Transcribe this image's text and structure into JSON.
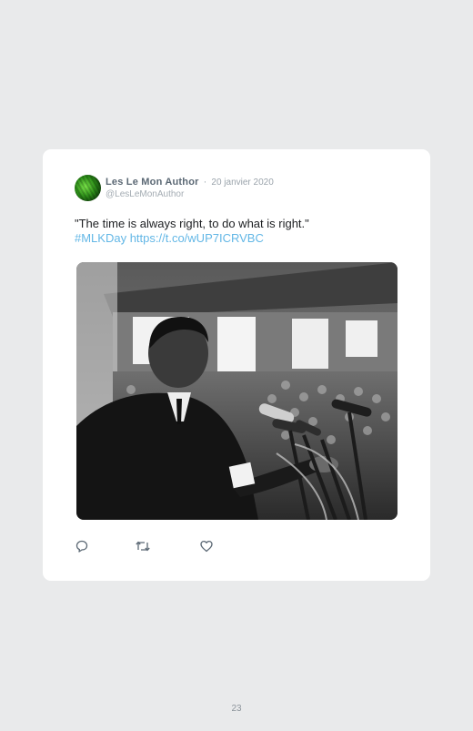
{
  "tweet": {
    "author_name": "Les Le Mon Author",
    "separator": "·",
    "date": "20 janvier 2020",
    "handle": "@LesLeMonAuthor",
    "text": "\"The time is always right, to do what is right.\"",
    "hashtag": "#MLKDay",
    "link": "https://t.co/wUP7ICRVBC",
    "image_alt": "Black and white photo of a man speaking into microphones before a crowd"
  },
  "actions": {
    "reply_icon": "reply-icon",
    "retweet_icon": "retweet-icon",
    "like_icon": "like-icon"
  },
  "page": {
    "number": "23"
  },
  "colors": {
    "background": "#e9eaeb",
    "card": "#ffffff",
    "link": "#63b7e6",
    "name": "#5b6874"
  }
}
